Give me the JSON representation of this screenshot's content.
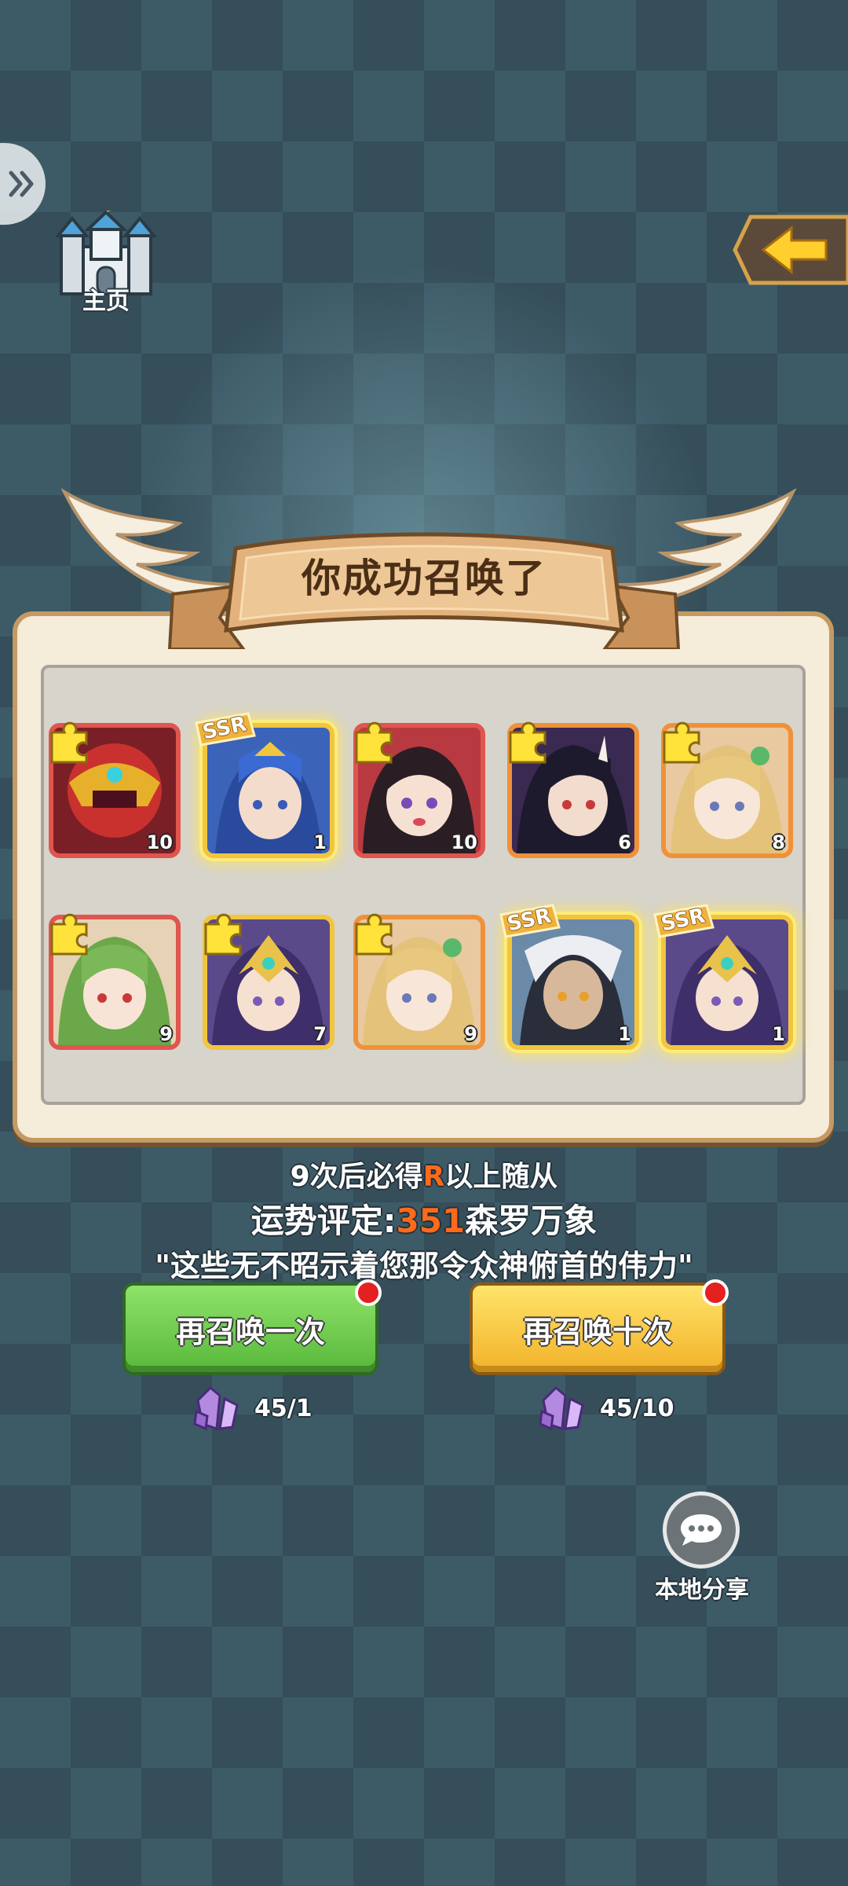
{
  "nav": {
    "home_label": "主页",
    "home_icon": "castle-icon",
    "back_icon": "arrow-left-icon",
    "side_icon": "double-chevron-right-icon"
  },
  "result": {
    "title": "你成功召唤了",
    "cards": [
      {
        "count": "10",
        "frame": "red",
        "badge": "fragment"
      },
      {
        "count": "1",
        "frame": "gold",
        "badge": "SSR",
        "glow": true
      },
      {
        "count": "10",
        "frame": "red",
        "badge": "fragment"
      },
      {
        "count": "6",
        "frame": "orange",
        "badge": "fragment"
      },
      {
        "count": "8",
        "frame": "orange",
        "badge": "fragment"
      },
      {
        "count": "9",
        "frame": "red",
        "badge": "fragment"
      },
      {
        "count": "7",
        "frame": "gold",
        "badge": "fragment"
      },
      {
        "count": "9",
        "frame": "orange",
        "badge": "fragment"
      },
      {
        "count": "1",
        "frame": "gold",
        "badge": "SSR",
        "glow": true
      },
      {
        "count": "1",
        "frame": "gold",
        "badge": "SSR",
        "glow": true
      }
    ],
    "ssr_label": "SSR"
  },
  "info": {
    "pity_prefix": "9次后必得",
    "pity_rank": "R",
    "pity_suffix": "以上随从",
    "fortune_prefix": "运势评定:",
    "fortune_score": "351",
    "fortune_rank": "森罗万象",
    "quote": "\"这些无不昭示着您那令众神俯首的伟力\""
  },
  "actions": {
    "summon_once": "再召唤一次",
    "summon_ten": "再召唤十次",
    "cost_once": "45/1",
    "cost_ten": "45/10",
    "currency_icon": "crystal-icon"
  },
  "share": {
    "label": "本地分享",
    "icon": "chat-bubble-icon"
  },
  "colors": {
    "highlight": "#ff6a1a",
    "green_button": "#58b83b",
    "yellow_button": "#f2b22a",
    "frame_red": "#e0554e",
    "frame_orange": "#f0913a",
    "frame_gold": "#f2c53e"
  }
}
